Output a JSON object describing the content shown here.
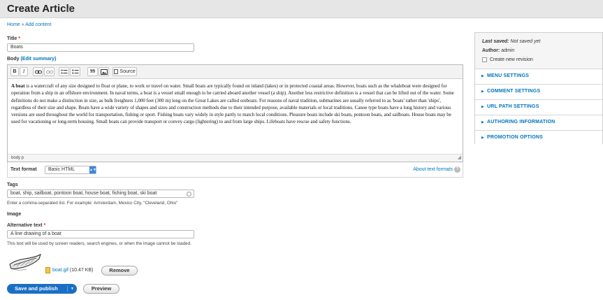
{
  "header": {
    "title": "Create Article"
  },
  "breadcrumb": {
    "home": "Home",
    "separator": "»",
    "current": "Add content"
  },
  "title_field": {
    "label": "Title",
    "required": "*",
    "value": "Boats"
  },
  "body_field": {
    "label": "Body",
    "edit_summary": "(Edit summary)",
    "toolbar": {
      "bold": "B",
      "italic": "I",
      "blockquote": "99",
      "source": "Source"
    },
    "content_lead": "A boat",
    "content": " is a watercraft of any size designed to float or plane, to work or travel on water. Small boats are typically found on inland (lakes) or in protected coastal areas. However, boats such as the whaleboat were designed for operation from a ship in an offshore environment. In naval terms, a boat is a vessel small enough to be carried aboard another vessel (a ship). Another less restrictive definition is a vessel that can be lifted out of the water. Some definitions do not make a distinction in size, as bulk freighters 1,000 feet (300 m) long on the Great Lakes are called oreboats. For reasons of naval tradition, submarines are usually referred to as 'boats' rather than 'ships', regardless of their size and shape. Boats have a wide variety of shapes and sizes and construction methods due to their intended purpose, available materials or local traditions. Canoe type boats have a long history and various versions are used throughout the world for transportation, fishing or sport. Fishing boats vary widely in style partly to match local conditions. Pleasure boats include ski boats, pontoon boats, and sailboats. House boats may be used for vacationing or long-term housing. Small boats can provide transport or convey cargo (lightering) to and from large ships. Lifeboats have rescue and safety functions.",
    "path": "body  p"
  },
  "text_format": {
    "label": "Text format",
    "selected": "Basic HTML",
    "about_link": "About text formats",
    "help": "?"
  },
  "tags": {
    "label": "Tags",
    "value": "boat, ship, sailboat, pontoon boat, house boat, fishing boat, ski boat",
    "description": "Enter a comma-separated list. For example: Amsterdam, Mexico City, \"Cleveland, Ohio\""
  },
  "image": {
    "label": "Image",
    "alt_label": "Alternative text",
    "alt_required": "*",
    "alt_value": "A line drawing of a boat",
    "alt_description": "This text will be used by screen readers, search engines, or when the image cannot be loaded.",
    "file_name": "boat.gif",
    "file_size": "(10.47 KB)",
    "remove_label": "Remove"
  },
  "actions": {
    "save": "Save and publish",
    "preview": "Preview"
  },
  "sidebar": {
    "last_saved_label": "Last saved:",
    "last_saved_value": "Not saved yet",
    "author_label": "Author:",
    "author_value": "admin",
    "new_revision": "Create new revision",
    "sections": [
      "MENU SETTINGS",
      "COMMENT SETTINGS",
      "URL PATH SETTINGS",
      "AUTHORING INFORMATION",
      "PROMOTION OPTIONS"
    ]
  },
  "colors": {
    "link": "#0074bd",
    "primary_button": "#1a6fc4",
    "required": "#e32700",
    "header_bg": "#e6e6e6"
  },
  "icons": [
    "star-icon",
    "bold-icon",
    "italic-icon",
    "link-icon",
    "unlink-icon",
    "bulleted-list-icon",
    "numbered-list-icon",
    "blockquote-icon",
    "image-icon",
    "source-icon",
    "resize-icon",
    "help-icon",
    "autocomplete-icon",
    "file-icon",
    "caret-down-icon",
    "chevron-right-icon"
  ]
}
